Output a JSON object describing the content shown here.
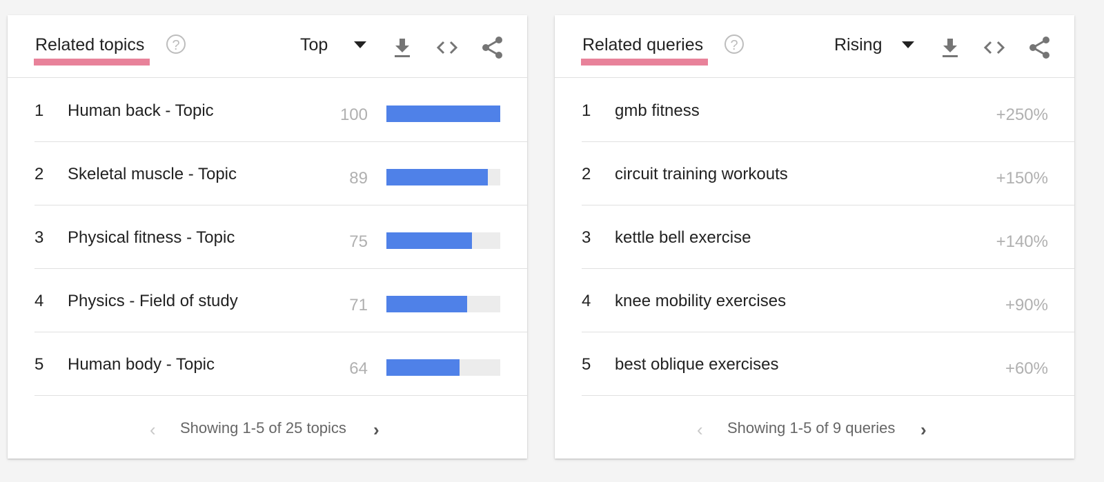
{
  "topics": {
    "title": "Related topics",
    "mode": "Top",
    "accent_underline_color": "#e8829a",
    "bar_color": "#4f81e8",
    "icons": [
      "help-icon",
      "download-icon",
      "embed-code-icon",
      "share-icon"
    ],
    "rows": [
      {
        "rank": "1",
        "label": "Human back - Topic",
        "value": "100",
        "fraction": 1.0
      },
      {
        "rank": "2",
        "label": "Skeletal muscle - Topic",
        "value": "89",
        "fraction": 0.89
      },
      {
        "rank": "3",
        "label": "Physical fitness - Topic",
        "value": "75",
        "fraction": 0.75
      },
      {
        "rank": "4",
        "label": "Physics - Field of study",
        "value": "71",
        "fraction": 0.71
      },
      {
        "rank": "5",
        "label": "Human body - Topic",
        "value": "64",
        "fraction": 0.64
      }
    ],
    "pagination": "Showing 1-5 of 25 topics"
  },
  "queries": {
    "title": "Related queries",
    "mode": "Rising",
    "icons": [
      "help-icon",
      "download-icon",
      "embed-code-icon",
      "share-icon"
    ],
    "rows": [
      {
        "rank": "1",
        "label": "gmb fitness",
        "value": "+250%"
      },
      {
        "rank": "2",
        "label": "circuit training workouts",
        "value": "+150%"
      },
      {
        "rank": "3",
        "label": "kettle bell exercise",
        "value": "+140%"
      },
      {
        "rank": "4",
        "label": "knee mobility exercises",
        "value": "+90%"
      },
      {
        "rank": "5",
        "label": "best oblique exercises",
        "value": "+60%"
      }
    ],
    "pagination": "Showing 1-5 of 9 queries"
  },
  "glyphs": {
    "help": "?",
    "prev": "‹",
    "next": "›"
  }
}
